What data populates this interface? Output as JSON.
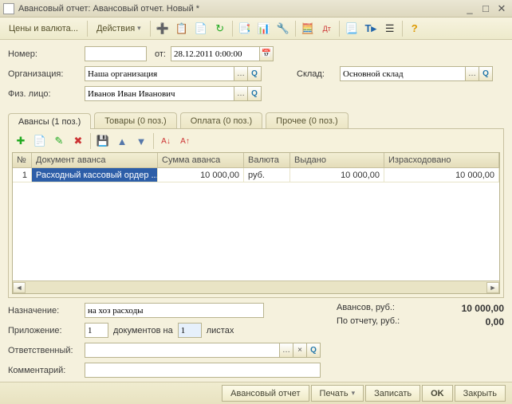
{
  "titlebar": {
    "title": "Авансовый отчет: Авансовый отчет. Новый *"
  },
  "toolbar": {
    "prices": "Цены и валюта...",
    "actions": "Действия"
  },
  "form": {
    "number_label": "Номер:",
    "number": "",
    "from_label": "от:",
    "date": "28.12.2011 0:00:00",
    "org_label": "Организация:",
    "org": "Наша организация",
    "person_label": "Физ. лицо:",
    "person": "Иванов Иван Иванович",
    "sklad_label": "Склад:",
    "sklad": "Основной склад"
  },
  "tabs": {
    "t1": "Авансы (1 поз.)",
    "t2": "Товары (0 поз.)",
    "t3": "Оплата (0 поз.)",
    "t4": "Прочее (0 поз.)"
  },
  "grid": {
    "h_n": "№",
    "h_doc": "Документ аванса",
    "h_sum": "Сумма аванса",
    "h_cur": "Валюта",
    "h_issued": "Выдано",
    "h_spent": "Израсходовано",
    "row": {
      "n": "1",
      "doc": "Расходный кассовый ордер ...",
      "sum": "10 000,00",
      "cur": "руб.",
      "issued": "10 000,00",
      "spent": "10 000,00"
    }
  },
  "bottom": {
    "purpose_label": "Назначение:",
    "purpose": "на хоз расходы",
    "attach_label": "Приложение:",
    "docs": "1",
    "docs_label": "документов на",
    "sheets": "1",
    "sheets_label": "листах",
    "resp_label": "Ответственный:",
    "resp": "",
    "comment_label": "Комментарий:",
    "comment": "",
    "avans_label": "Авансов, руб.:",
    "avans_val": "10 000,00",
    "report_label": "По отчету, руб.:",
    "report_val": "0,00"
  },
  "footer": {
    "report": "Авансовый отчет",
    "print": "Печать",
    "write": "Записать",
    "ok": "OK",
    "close": "Закрыть"
  }
}
